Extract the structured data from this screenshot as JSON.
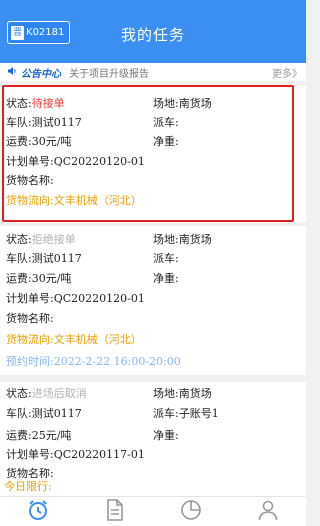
{
  "header": {
    "plate_prov": "晋",
    "plate_num": "K02181",
    "title": "我的任务"
  },
  "notice": {
    "tag": "公告中心",
    "text": "关于项目升级报告",
    "more": "更多》"
  },
  "cards": [
    {
      "status_label": "状态:",
      "status": "待接单",
      "site_label": "场地:",
      "site": "南货场",
      "team_label": "车队:",
      "team": "测试0117",
      "dispatch_label": "派车:",
      "dispatch": "",
      "freight_label": "运费:",
      "freight": "30元/吨",
      "net_label": "净重:",
      "net": "",
      "plan": "计划单号:QC20220120-01",
      "goods": "货物名称:",
      "flow": "货物流向:文丰机械（河北）"
    },
    {
      "status_label": "状态:",
      "status": "拒绝接单",
      "site_label": "场地:",
      "site": "南货场",
      "team_label": "车队:",
      "team": "测试0117",
      "dispatch_label": "派车:",
      "dispatch": "",
      "freight_label": "运费:",
      "freight": "30元/吨",
      "net_label": "净重:",
      "net": "",
      "plan": "计划单号:QC20220120-01",
      "goods": "货物名称:",
      "flow": "货物流向:文丰机械（河北）",
      "appoint": "预约时间:2022-2-22 16:00-20:00"
    },
    {
      "status_label": "状态:",
      "status": "进场后取消",
      "site_label": "场地:",
      "site": "南货场",
      "team_label": "车队:",
      "team": "测试0117",
      "dispatch_label": "派车:",
      "dispatch": "子账号1",
      "freight_label": "运费:",
      "freight": "25元/吨",
      "net_label": "净重:",
      "net": "",
      "plan": "计划单号:QC20220117-01",
      "goods": "货物名称:"
    }
  ],
  "today": "今日限行:",
  "tabs": [
    "alarm-clock-icon",
    "document-icon",
    "pie-chart-icon",
    "user-icon"
  ]
}
